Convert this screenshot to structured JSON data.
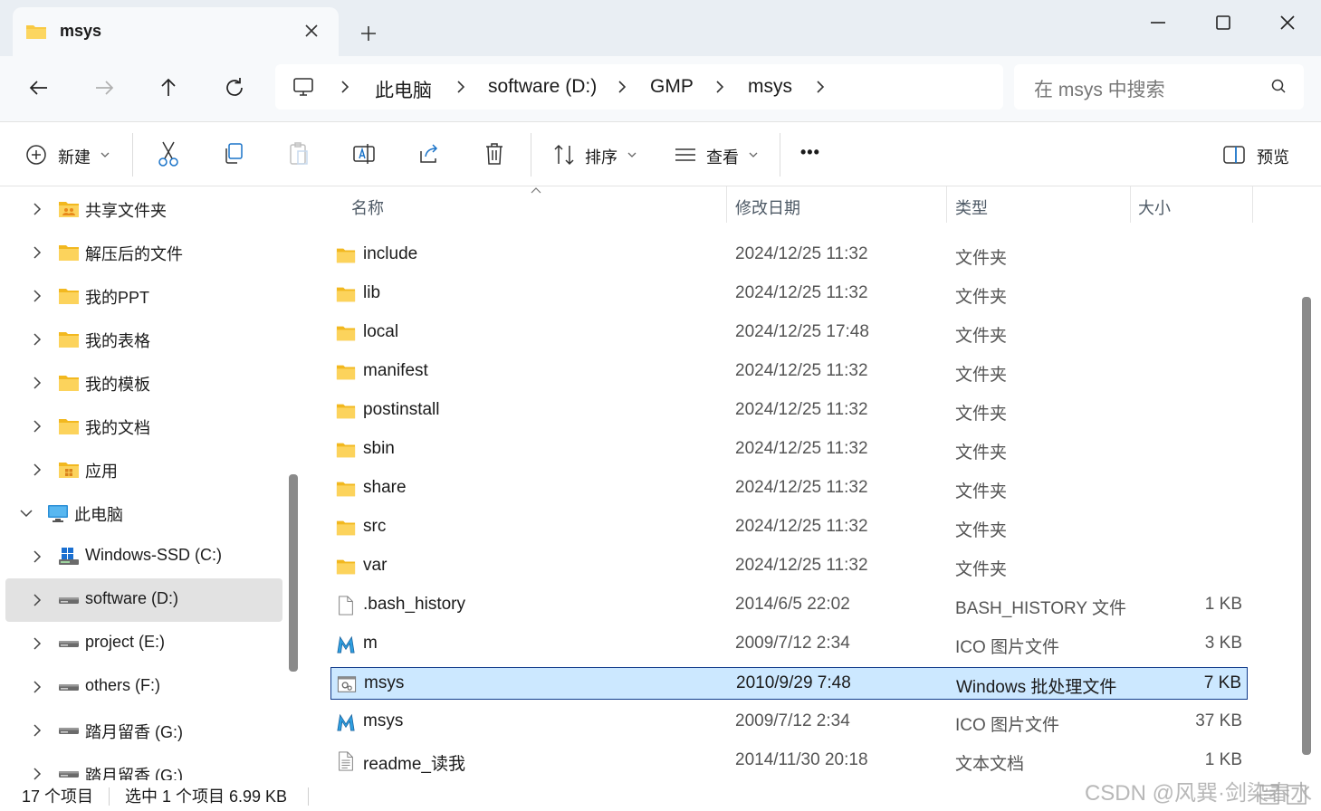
{
  "tab": {
    "title": "msys",
    "close_icon": "close-icon",
    "new_tab_icon": "plus-icon"
  },
  "window_controls": {
    "minimize": "minimize-icon",
    "maximize": "maximize-icon",
    "close": "close-icon"
  },
  "nav": {
    "back": "arrow-left-icon",
    "forward": "arrow-right-icon",
    "up": "arrow-up-icon",
    "refresh": "refresh-icon"
  },
  "breadcrumb": {
    "root_icon": "computer-icon",
    "items": [
      "此电脑",
      "software (D:)",
      "GMP",
      "msys"
    ]
  },
  "search": {
    "placeholder": "在 msys 中搜索"
  },
  "toolbar": {
    "new_label": "新建",
    "sort_label": "排序",
    "view_label": "查看",
    "more_label": "•••",
    "preview_label": "预览"
  },
  "sidebar": {
    "items": [
      {
        "label": "共享文件夹",
        "icon": "shared-folder-icon"
      },
      {
        "label": "解压后的文件",
        "icon": "folder-icon"
      },
      {
        "label": "我的PPT",
        "icon": "folder-icon"
      },
      {
        "label": "我的表格",
        "icon": "folder-icon"
      },
      {
        "label": "我的模板",
        "icon": "folder-icon"
      },
      {
        "label": "我的文档",
        "icon": "folder-icon"
      },
      {
        "label": "应用",
        "icon": "apps-folder-icon"
      },
      {
        "label": "此电脑",
        "icon": "computer-icon",
        "expanded": true
      },
      {
        "label": "Windows-SSD (C:)",
        "icon": "windows-drive-icon"
      },
      {
        "label": "software (D:)",
        "icon": "drive-icon",
        "selected": true
      },
      {
        "label": "project (E:)",
        "icon": "drive-icon"
      },
      {
        "label": "others (F:)",
        "icon": "drive-icon"
      },
      {
        "label": "踏月留香 (G:)",
        "icon": "drive-icon"
      },
      {
        "label": "踏月留香 (G:)",
        "icon": "drive-icon"
      }
    ]
  },
  "columns": {
    "name": "名称",
    "date": "修改日期",
    "type": "类型",
    "size": "大小"
  },
  "files": [
    {
      "name": "include",
      "date": "2024/12/25 11:32",
      "type": "文件夹",
      "size": "",
      "icon": "folder-icon"
    },
    {
      "name": "lib",
      "date": "2024/12/25 11:32",
      "type": "文件夹",
      "size": "",
      "icon": "folder-icon"
    },
    {
      "name": "local",
      "date": "2024/12/25 17:48",
      "type": "文件夹",
      "size": "",
      "icon": "folder-icon"
    },
    {
      "name": "manifest",
      "date": "2024/12/25 11:32",
      "type": "文件夹",
      "size": "",
      "icon": "folder-icon"
    },
    {
      "name": "postinstall",
      "date": "2024/12/25 11:32",
      "type": "文件夹",
      "size": "",
      "icon": "folder-icon"
    },
    {
      "name": "sbin",
      "date": "2024/12/25 11:32",
      "type": "文件夹",
      "size": "",
      "icon": "folder-icon"
    },
    {
      "name": "share",
      "date": "2024/12/25 11:32",
      "type": "文件夹",
      "size": "",
      "icon": "folder-icon"
    },
    {
      "name": "src",
      "date": "2024/12/25 11:32",
      "type": "文件夹",
      "size": "",
      "icon": "folder-icon"
    },
    {
      "name": "var",
      "date": "2024/12/25 11:32",
      "type": "文件夹",
      "size": "",
      "icon": "folder-icon"
    },
    {
      "name": ".bash_history",
      "date": "2014/6/5 22:02",
      "type": "BASH_HISTORY 文件",
      "size": "1 KB",
      "icon": "file-icon"
    },
    {
      "name": "m",
      "date": "2009/7/12 2:34",
      "type": "ICO 图片文件",
      "size": "3 KB",
      "icon": "msys-ico-icon"
    },
    {
      "name": "msys",
      "date": "2010/9/29 7:48",
      "type": "Windows 批处理文件",
      "size": "7 KB",
      "icon": "batch-file-icon",
      "selected": true
    },
    {
      "name": "msys",
      "date": "2009/7/12 2:34",
      "type": "ICO 图片文件",
      "size": "37 KB",
      "icon": "msys-ico-icon"
    },
    {
      "name": "readme_读我",
      "date": "2014/11/30 20:18",
      "type": "文本文档",
      "size": "1 KB",
      "icon": "text-file-icon"
    }
  ],
  "status": {
    "count": "17 个项目",
    "selection": "选中 1 个项目  6.99 KB"
  },
  "watermark": "CSDN @风巽·剑染春水",
  "colors": {
    "selection_bg": "#cce8ff",
    "selection_border": "#0f3a8a",
    "folder": "#f8c943"
  }
}
